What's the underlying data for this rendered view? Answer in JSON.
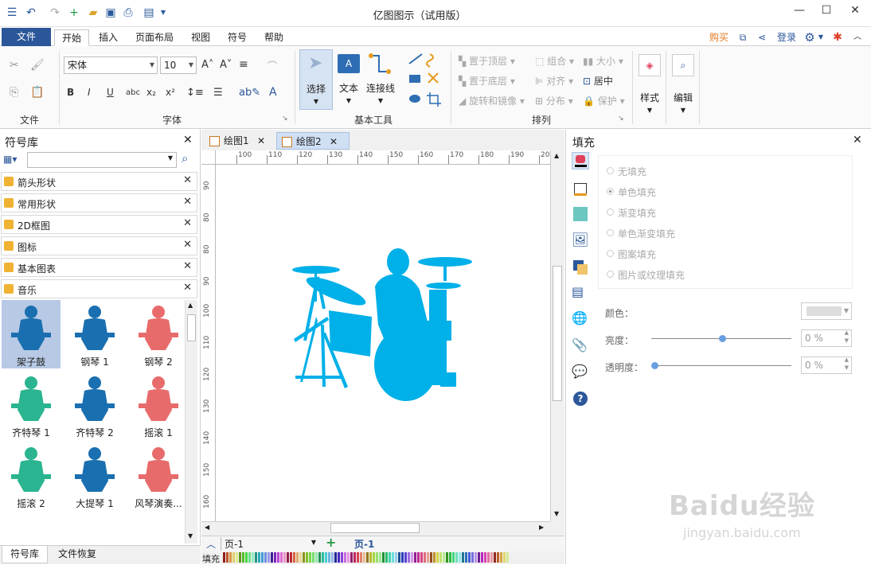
{
  "app": {
    "title": "亿图图示（试用版）"
  },
  "menu": {
    "file": "文件",
    "tabs": [
      "开始",
      "插入",
      "页面布局",
      "视图",
      "符号",
      "帮助"
    ],
    "buy": "购买",
    "login": "登录"
  },
  "ribbon": {
    "groups": {
      "file": "文件",
      "font": "字体",
      "basic_tools": "基本工具",
      "arrange": "排列"
    },
    "font_name": "宋体",
    "font_size": "10",
    "select": "选择",
    "text": "文本",
    "connector": "连接线",
    "bring_front": "置于顶层",
    "send_back": "置于底层",
    "rotate_mirror": "旋转和镜像",
    "group": "组合",
    "align": "对齐",
    "distribute": "分布",
    "size": "大小",
    "center": "居中",
    "protect": "保护",
    "style": "样式",
    "edit": "编辑"
  },
  "library": {
    "title": "符号库",
    "categories": [
      "箭头形状",
      "常用形状",
      "2D框图",
      "图标",
      "基本图表",
      "音乐"
    ],
    "symbols": [
      {
        "label": "架子鼓",
        "color": "#1a6fb0"
      },
      {
        "label": "钢琴 1",
        "color": "#1a6fb0"
      },
      {
        "label": "钢琴 2",
        "color": "#e86b6b"
      },
      {
        "label": "齐特琴 1",
        "color": "#2ab48f"
      },
      {
        "label": "齐特琴 2",
        "color": "#1a6fb0"
      },
      {
        "label": "摇滚 1",
        "color": "#e86b6b"
      },
      {
        "label": "摇滚 2",
        "color": "#2ab48f"
      },
      {
        "label": "大提琴 1",
        "color": "#1a6fb0"
      },
      {
        "label": "风琴演奏...",
        "color": "#e86b6b"
      }
    ],
    "bottom_tabs": [
      "符号库",
      "文件恢复"
    ]
  },
  "documents": {
    "tabs": [
      "绘图1",
      "绘图2"
    ],
    "ruler_h": [
      "100",
      "110",
      "120",
      "130",
      "140",
      "150",
      "160",
      "170",
      "180",
      "190",
      "200"
    ],
    "ruler_v": [
      "90",
      "80",
      "80",
      "90",
      "100",
      "110",
      "120",
      "130",
      "140",
      "150",
      "160"
    ],
    "page_select": "页-1",
    "page_tab": "页-1",
    "fill_label": "填充",
    "shape_color": "#00b0e8"
  },
  "fill_panel": {
    "title": "填充",
    "options": [
      "无填充",
      "单色填充",
      "渐变填充",
      "单色渐变填充",
      "图案填充",
      "图片或纹理填充"
    ],
    "color_label": "颜色：",
    "brightness_label": "亮度：",
    "brightness_value": "0 %",
    "transparency_label": "透明度：",
    "transparency_value": "0 %"
  },
  "watermark": {
    "brand": "Baidu经验",
    "url": "jingyan.baidu.com"
  }
}
